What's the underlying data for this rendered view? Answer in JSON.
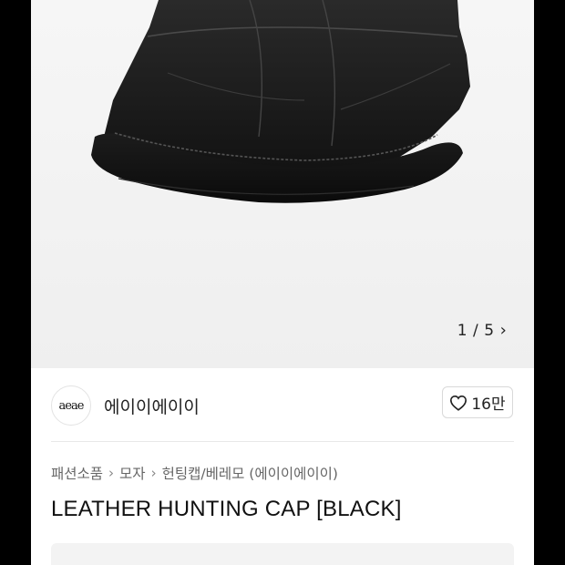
{
  "gallery": {
    "image_alt": "black leather hunting cap",
    "pager_current": "1",
    "pager_separator": "/",
    "pager_total": "5",
    "pager_next_icon": "chevron-right-icon"
  },
  "brand": {
    "logo_text": "aeae",
    "name": "에이이에이이"
  },
  "like": {
    "icon": "heart-outline-icon",
    "count": "16만"
  },
  "breadcrumb": {
    "items": [
      "패션소품",
      "모자",
      "헌팅캡/베레모 (에이이에이이)"
    ],
    "separator": "›"
  },
  "product": {
    "title": "LEATHER HUNTING CAP [BLACK]"
  },
  "colors": {
    "background": "#000000",
    "page": "#ffffff",
    "gallery_bg": "#f2f2f2",
    "text_primary": "#111111",
    "text_secondary": "#666666"
  }
}
